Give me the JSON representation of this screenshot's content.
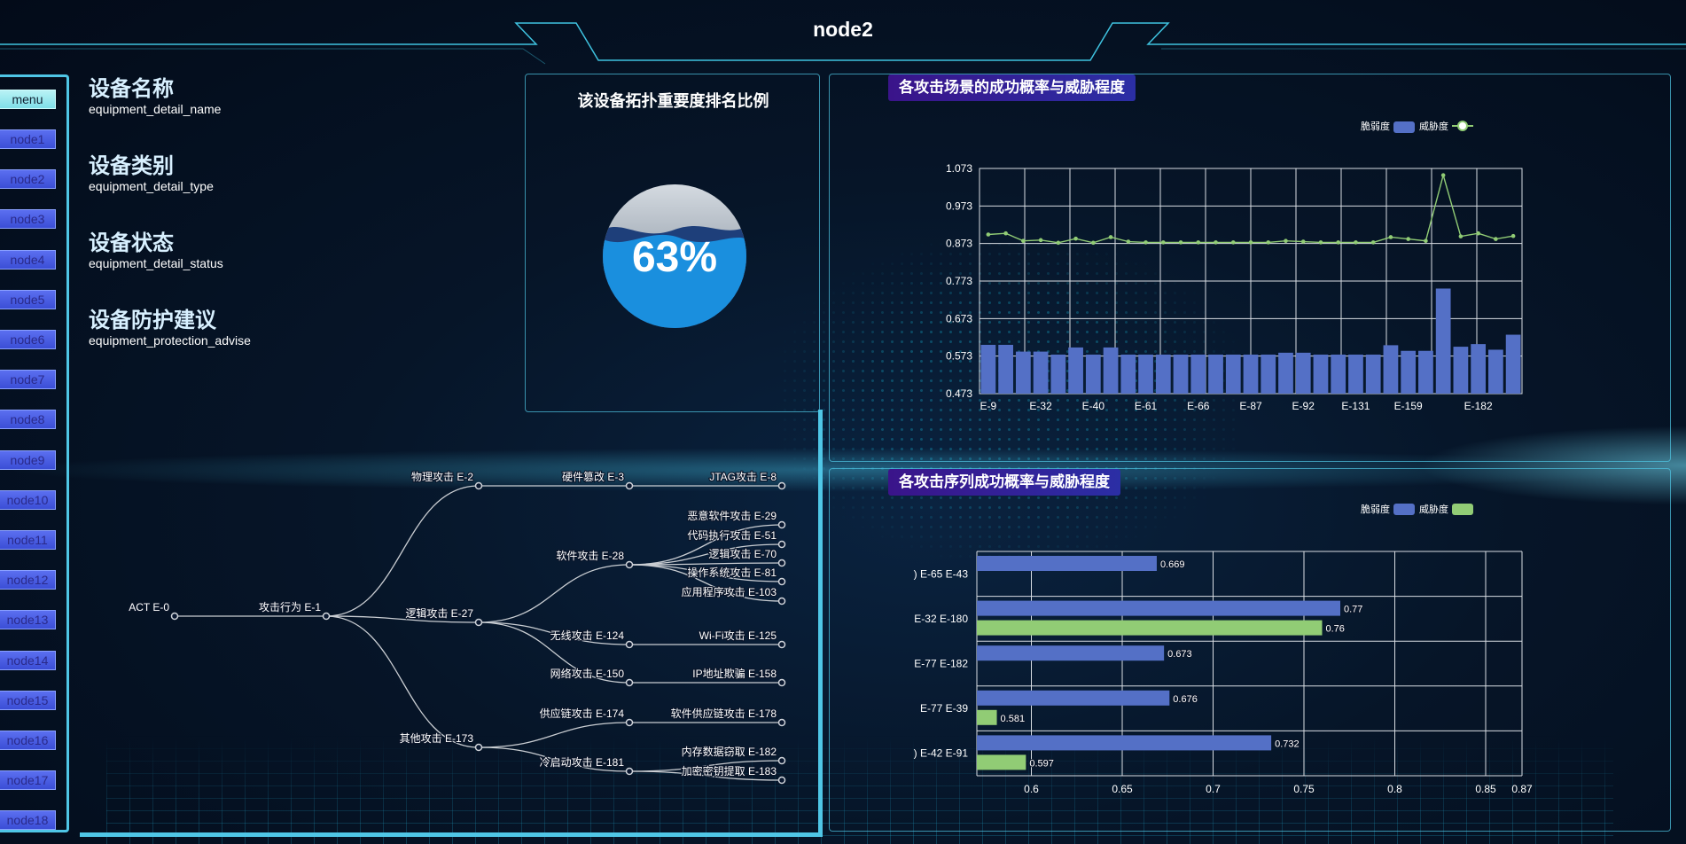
{
  "header": {
    "title": "node2"
  },
  "sidebar": {
    "menu_label": "menu",
    "items": [
      "node1",
      "node2",
      "node3",
      "node4",
      "node5",
      "node6",
      "node7",
      "node8",
      "node9",
      "node10",
      "node11",
      "node12",
      "node13",
      "node14",
      "node15",
      "node16",
      "node17",
      "node18"
    ]
  },
  "info": [
    {
      "heading": "设备名称",
      "value": "equipment_detail_name"
    },
    {
      "heading": "设备类别",
      "value": "equipment_detail_type"
    },
    {
      "heading": "设备状态",
      "value": "equipment_detail_status"
    },
    {
      "heading": "设备防护建议",
      "value": "equipment_protection_advise"
    }
  ],
  "gauge": {
    "title": "该设备拓扑重要度排名比例",
    "value_label": "63%",
    "value": 0.63
  },
  "tree": {
    "nodes": [
      {
        "id": "root",
        "label": "ACT E-0"
      },
      {
        "id": "n1",
        "label": "攻击行为 E-1"
      },
      {
        "id": "n2",
        "label": "物理攻击 E-2"
      },
      {
        "id": "n3",
        "label": "硬件篡改 E-3"
      },
      {
        "id": "n8",
        "label": "JTAG攻击 E-8"
      },
      {
        "id": "n27",
        "label": "逻辑攻击 E-27"
      },
      {
        "id": "n28",
        "label": "软件攻击 E-28"
      },
      {
        "id": "n29",
        "label": "恶意软件攻击 E-29"
      },
      {
        "id": "n51",
        "label": "代码执行攻击 E-51"
      },
      {
        "id": "n70",
        "label": "逻辑攻击 E-70"
      },
      {
        "id": "n81",
        "label": "操作系统攻击 E-81"
      },
      {
        "id": "n103",
        "label": "应用程序攻击 E-103"
      },
      {
        "id": "n124",
        "label": "无线攻击 E-124"
      },
      {
        "id": "n125",
        "label": "Wi-Fi攻击 E-125"
      },
      {
        "id": "n150",
        "label": "网络攻击 E-150"
      },
      {
        "id": "n158",
        "label": "IP地址欺骗 E-158"
      },
      {
        "id": "n173",
        "label": "其他攻击 E-173"
      },
      {
        "id": "n174",
        "label": "供应链攻击 E-174"
      },
      {
        "id": "n178",
        "label": "软件供应链攻击 E-178"
      },
      {
        "id": "n181",
        "label": "冷启动攻击 E-181"
      },
      {
        "id": "n182",
        "label": "内存数据窃取 E-182"
      },
      {
        "id": "n183",
        "label": "加密密钥提取 E-183"
      }
    ]
  },
  "chart_top": {
    "panel_title": "各攻击场景的成功概率与威胁程度",
    "chart_data": {
      "type": "bar",
      "categories": [
        "E-9",
        "",
        "",
        "E-32",
        "",
        "",
        "E-40",
        "",
        "",
        "E-61",
        "",
        "",
        "E-66",
        "",
        "",
        "E-87",
        "",
        "",
        "E-92",
        "",
        "",
        "E-131",
        "",
        "",
        "E-159",
        "",
        "",
        "E-182",
        "",
        ""
      ],
      "tick_labels": [
        "E-9",
        "E-32",
        "E-40",
        "E-61",
        "E-66",
        "E-87",
        "E-92",
        "E-131",
        "E-159",
        "E-182"
      ],
      "series": [
        {
          "name": "脆弱度",
          "type": "bar",
          "color": "#5470c6",
          "values": [
            0.603,
            0.603,
            0.585,
            0.585,
            0.577,
            0.596,
            0.577,
            0.596,
            0.577,
            0.577,
            0.577,
            0.577,
            0.577,
            0.577,
            0.577,
            0.577,
            0.577,
            0.582,
            0.582,
            0.577,
            0.577,
            0.577,
            0.577,
            0.602,
            0.587,
            0.587,
            0.753,
            0.598,
            0.605,
            0.59,
            0.63
          ]
        },
        {
          "name": "威胁度",
          "type": "line",
          "color": "#91cc75",
          "values": [
            0.897,
            0.9,
            0.88,
            0.882,
            0.875,
            0.886,
            0.875,
            0.89,
            0.878,
            0.876,
            0.876,
            0.876,
            0.876,
            0.876,
            0.876,
            0.876,
            0.876,
            0.88,
            0.878,
            0.876,
            0.876,
            0.876,
            0.876,
            0.89,
            0.885,
            0.88,
            1.055,
            0.892,
            0.9,
            0.885,
            0.893
          ]
        }
      ],
      "yticks": [
        "0.473",
        "0.573",
        "0.673",
        "0.773",
        "0.873",
        "0.973",
        "1.073"
      ],
      "ylim": [
        0.473,
        1.073
      ],
      "legend": "top-right"
    }
  },
  "chart_bottom": {
    "panel_title": "各攻击序列成功概率与威胁程度",
    "chart_data": {
      "type": "bar",
      "orientation": "horizontal",
      "categories": [
        "E-65 E-43",
        "E-32 E-180",
        "E-77 E-182",
        "E-77 E-39",
        "E-42 E-91"
      ],
      "category_labels": [
        ") E-65 E-43",
        "E-32 E-180",
        "E-77 E-182",
        "E-77 E-39",
        ") E-42 E-91"
      ],
      "series": [
        {
          "name": "脆弱度",
          "color": "#5470c6",
          "values": [
            0.669,
            0.77,
            0.673,
            0.676,
            0.732
          ],
          "labels": [
            "0.669",
            "0.77",
            "0.673",
            "0.676",
            "0.732"
          ]
        },
        {
          "name": "威胁度",
          "color": "#91cc75",
          "values": [
            null,
            0.76,
            null,
            0.581,
            0.597
          ],
          "labels": [
            "",
            "0.76",
            "",
            "0.581",
            "0.597"
          ]
        }
      ],
      "xticks": [
        "0.6",
        "0.65",
        "0.7",
        "0.75",
        "0.8",
        "0.85",
        "0.87"
      ],
      "xlim": [
        0.57,
        0.87
      ],
      "legend": "top-right"
    }
  }
}
